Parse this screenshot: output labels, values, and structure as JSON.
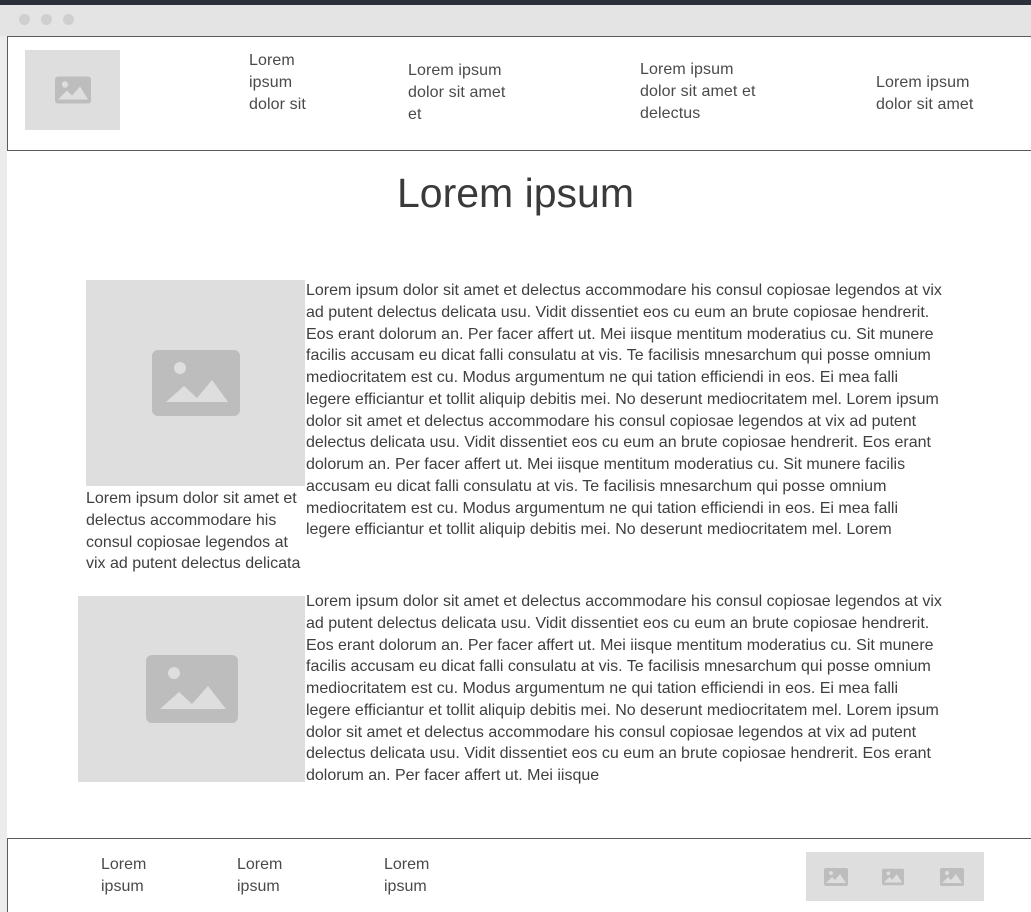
{
  "header": {
    "nav": [
      "Lorem ipsum dolor sit",
      "Lorem ipsum dolor sit amet et",
      "Lorem ipsum dolor sit amet et delectus",
      "Lorem ipsum dolor sit amet"
    ]
  },
  "main": {
    "title": "Lorem ipsum",
    "caption": "Lorem ipsum dolor sit amet et delectus accommodare his consul copiosae legendos at vix ad putent delectus delicata",
    "paragraph_1": "Lorem ipsum dolor sit amet et delectus accommodare his consul copiosae legendos at vix ad putent delectus delicata usu. Vidit dissentiet eos cu eum an brute copiosae hendrerit. Eos erant dolorum an. Per facer affert ut. Mei iisque mentitum moderatius cu. Sit munere facilis accusam eu dicat falli consulatu at vis. Te facilisis mnesarchum qui posse omnium mediocritatem est cu. Modus argumentum ne qui tation efficiendi in eos. Ei mea falli legere efficiantur et tollit aliquip debitis mei. No deserunt mediocritatem mel. Lorem ipsum dolor sit amet et delectus accommodare his consul copiosae legendos at vix ad putent delectus delicata usu. Vidit dissentiet eos cu eum an brute copiosae hendrerit. Eos erant dolorum an. Per facer affert ut. Mei iisque mentitum moderatius cu. Sit munere facilis accusam eu dicat falli consulatu at vis. Te facilisis mnesarchum qui posse omnium mediocritatem est cu. Modus argumentum ne qui tation efficiendi in eos. Ei mea falli legere efficiantur et tollit aliquip debitis mei. No deserunt mediocritatem mel. Lorem",
    "paragraph_2": "Lorem ipsum dolor sit amet et delectus accommodare his consul copiosae legendos at vix ad putent delectus delicata usu. Vidit dissentiet eos cu eum an brute copiosae hendrerit. Eos erant dolorum an. Per facer affert ut. Mei iisque mentitum moderatius cu. Sit munere facilis accusam eu dicat falli consulatu at vis. Te facilisis mnesarchum qui posse omnium mediocritatem est cu. Modus argumentum ne qui tation efficiendi in eos. Ei mea falli legere efficiantur et tollit aliquip debitis mei. No deserunt mediocritatem mel. Lorem ipsum dolor sit amet et delectus accommodare his consul copiosae legendos at vix ad putent delectus delicata usu. Vidit dissentiet eos cu eum an brute copiosae hendrerit. Eos erant dolorum an. Per facer affert ut. Mei iisque"
  },
  "footer": {
    "links": [
      "Lorem ipsum",
      "Lorem ipsum",
      "Lorem ipsum"
    ]
  },
  "colors": {
    "placeholder_bg": "#dedede",
    "placeholder_icon": "#bdbdbd",
    "border": "#5a5a5a",
    "text": "#3f3f3f"
  },
  "icons": {
    "image_placeholder": "image-icon",
    "window_dot": "window-control-dot"
  }
}
